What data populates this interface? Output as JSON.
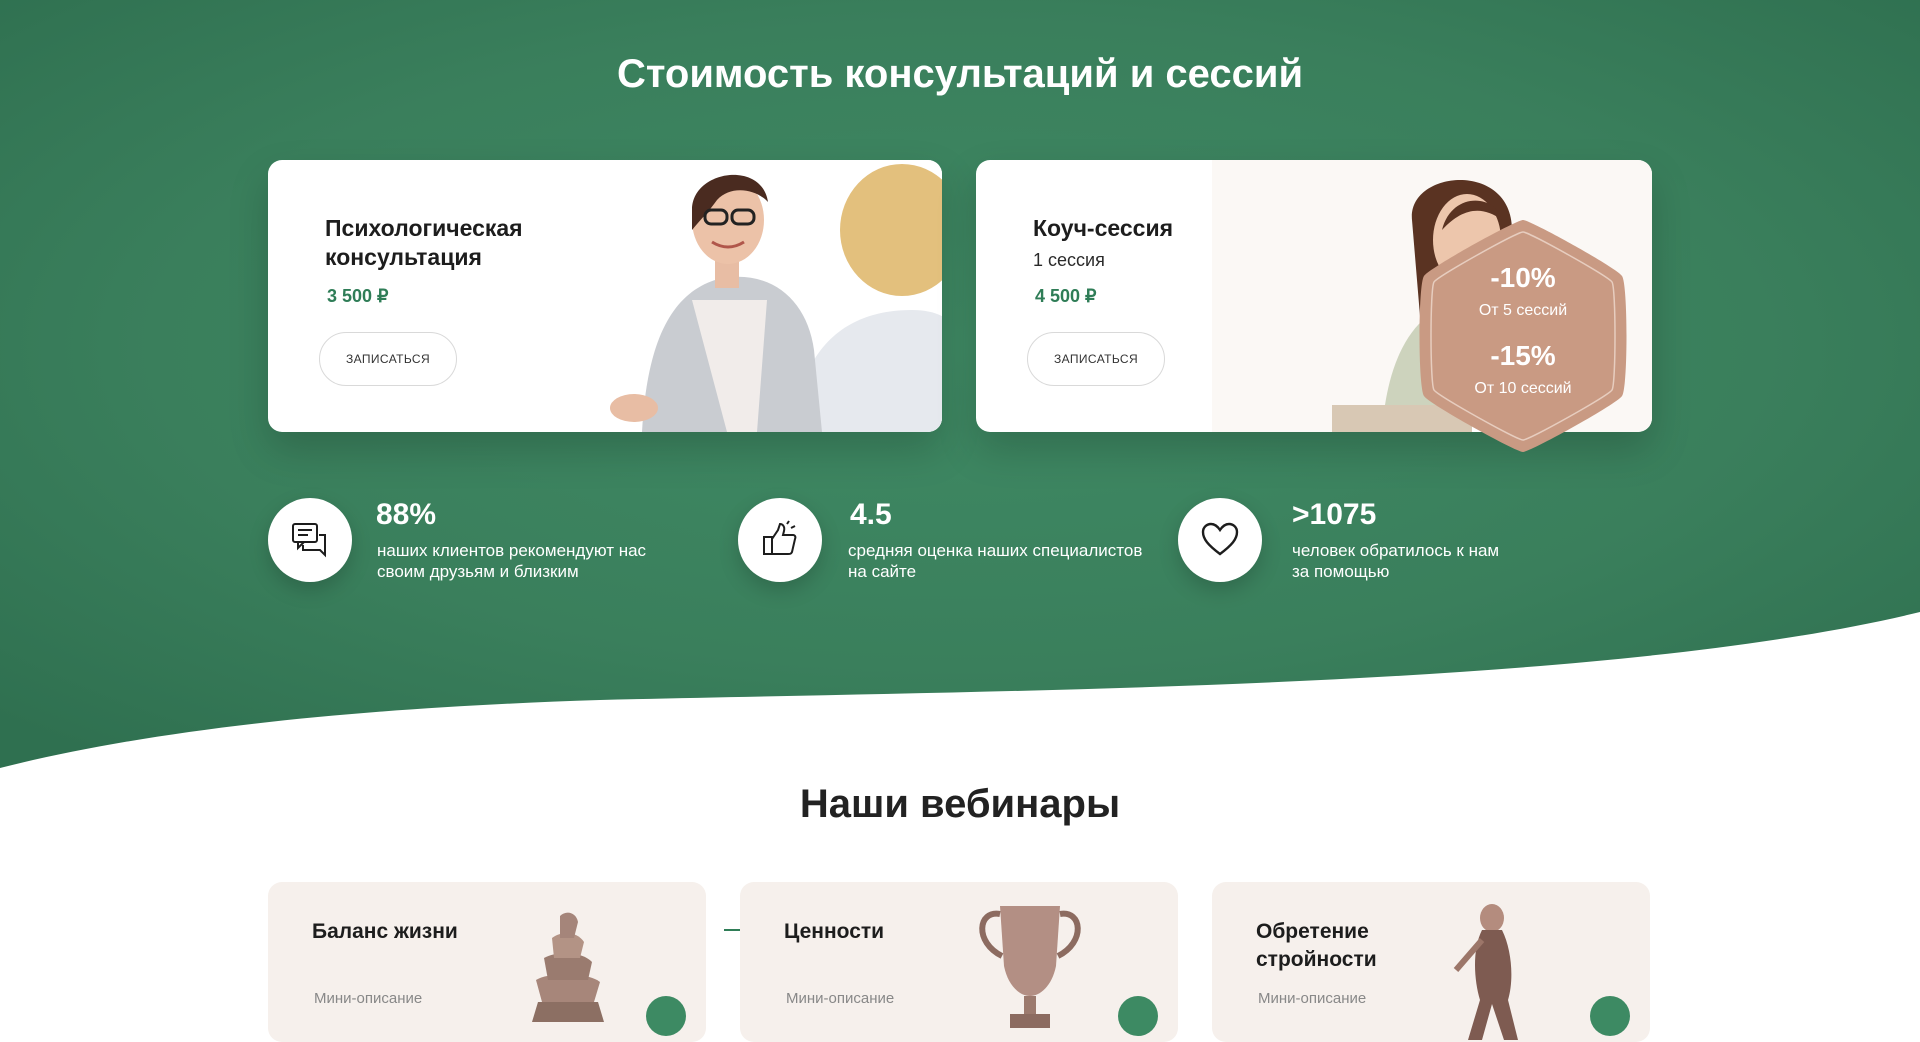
{
  "pricing": {
    "title": "Стоимость консультаций и сессий",
    "cards": [
      {
        "title": "Психологическая консультация",
        "subtitle": "",
        "price": "3 500 ₽",
        "button": "ЗАПИСАТЬСЯ"
      },
      {
        "title": "Коуч-сессия",
        "subtitle": "1 сессия",
        "price": "4 500 ₽",
        "button": "ЗАПИСАТЬСЯ"
      }
    ],
    "discount": {
      "first": {
        "percent": "-10%",
        "condition": "От 5 сессий"
      },
      "second": {
        "percent": "-15%",
        "condition": "От 10 сессий"
      }
    }
  },
  "stats": [
    {
      "icon": "chat-icon",
      "value": "88%",
      "text": "наших клиентов рекомендуют нас своим друзьям и близким"
    },
    {
      "icon": "thumbs-up-icon",
      "value": "4.5",
      "text": "средняя оценка наших специалистов на сайте"
    },
    {
      "icon": "heart-icon",
      "value": ">1075",
      "text": "человек обратилось к нам за помощью"
    }
  ],
  "webinars": {
    "title": "Наши вебинары",
    "items": [
      {
        "title": "Баланс жизни",
        "description": "Мини-описание",
        "image": "stacked-stones-image"
      },
      {
        "title": "Ценности",
        "description": "Мини-описание",
        "image": "trophy-cup-image"
      },
      {
        "title": "Обретение стройности",
        "description": "Мини-описание",
        "image": "slim-woman-image"
      }
    ]
  },
  "colors": {
    "brand_green": "#3a7f5c",
    "price_green": "#2f7d57",
    "badge_copper": "#c99a83",
    "card_bg": "#ffffff",
    "webinar_card_bg": "#f6f0ec"
  }
}
